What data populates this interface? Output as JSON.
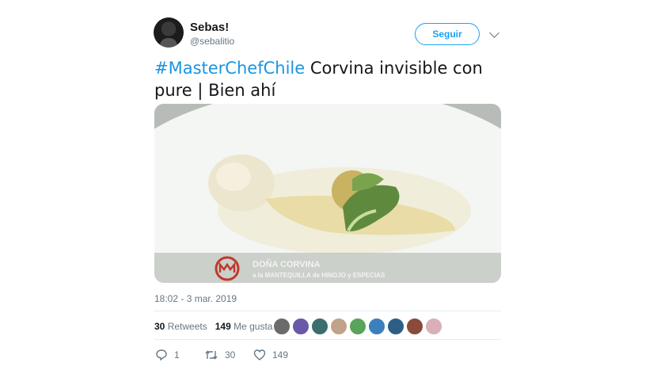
{
  "user": {
    "name": "Sebas!",
    "handle": "@sebalitio"
  },
  "follow_label": "Seguir",
  "tweet": {
    "hashtag": "#MasterChefChile",
    "text": " Corvina invisible con pure | Bien ahí"
  },
  "media": {
    "caption_title": "DOÑA CORVINA",
    "caption_sub": "a la MANTEQUILLA de HINOJO y ESPECIAS"
  },
  "timestamp": "18:02 - 3 mar. 2019",
  "stats": {
    "retweets": "30",
    "retweets_label": "Retweets",
    "likes": "149",
    "likes_label": "Me gusta"
  },
  "actions": {
    "reply_count": "1",
    "retweet_count": "30",
    "like_count": "149"
  },
  "colors": {
    "accent": "#1da1f2",
    "hashtag": "#1b95e0",
    "muted": "#657786"
  },
  "icons": [
    "chevron-down-icon",
    "reply-icon",
    "retweet-icon",
    "heart-icon",
    "masterchef-logo"
  ]
}
